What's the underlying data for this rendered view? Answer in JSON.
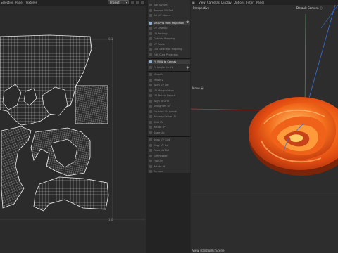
{
  "uv_editor": {
    "menu": [
      "Selection",
      "Panel",
      "Textures"
    ],
    "project_select": "Project",
    "tile_labels": {
      "u1": "0,1",
      "u2": "1,0"
    }
  },
  "tools": {
    "items": [
      {
        "label": "Add UV Set",
        "bright": false
      },
      {
        "label": "Remove UV Set",
        "bright": false
      },
      {
        "label": "Sel UV Seams",
        "bright": false
      },
      {
        "label": "Set UVW from Projection",
        "bright": true
      },
      {
        "label": "UV Unwrap",
        "bright": false
      },
      {
        "label": "UV Packing",
        "bright": false
      },
      {
        "label": "Optimal Mapping",
        "bright": false
      },
      {
        "label": "UV Relax",
        "bright": false
      },
      {
        "label": "Live Selection Mapping",
        "bright": false
      },
      {
        "label": "Edit Cube Projection",
        "bright": false
      },
      {
        "label": "Fit UVW to Canvas",
        "bright": true
      },
      {
        "label": "Fit Region to UV",
        "bright": false
      },
      {
        "label": "Mirror U",
        "bright": false
      },
      {
        "label": "Mirror V",
        "bright": false
      },
      {
        "label": "Align UV Set",
        "bright": false
      },
      {
        "label": "UV Manipulation",
        "bright": false
      },
      {
        "label": "UV Terrain Layout",
        "bright": false
      },
      {
        "label": "Align to Grid",
        "bright": false
      },
      {
        "label": "Straighten UV",
        "bright": false
      },
      {
        "label": "Equalize UV Islands",
        "bright": false
      },
      {
        "label": "Rectangularize UV",
        "bright": false
      },
      {
        "label": "Shift UV",
        "bright": false
      },
      {
        "label": "Rotate UV",
        "bright": false
      },
      {
        "label": "Scale UV",
        "bright": false
      },
      {
        "label": "Snap UV Grid",
        "bright": false
      },
      {
        "label": "Copy UV Sel",
        "bright": false
      },
      {
        "label": "Paste UV Sel",
        "bright": false
      },
      {
        "label": "Tile Repeat",
        "bright": false
      },
      {
        "label": "Flip UVs",
        "bright": false
      },
      {
        "label": "Rotate 90",
        "bright": false
      },
      {
        "label": "Remove",
        "bright": false
      }
    ]
  },
  "viewport": {
    "menu": [
      "View",
      "Cameras",
      "Display",
      "Options",
      "Filter",
      "Panel"
    ],
    "view_label": "Perspective",
    "camera_label": "Default Camera ⦿",
    "axis_label": "Move ⦿",
    "footer": "View Transform: Scene"
  },
  "colors": {
    "uv_wire": "#e8e8e8",
    "accent_blue": "#8fb0d6",
    "mesh_orange": "#ff7a1a",
    "mesh_red": "#d63a10",
    "axis_red": "#c0392b",
    "axis_green": "#3ca14b",
    "axis_blue": "#3b6fd8"
  }
}
